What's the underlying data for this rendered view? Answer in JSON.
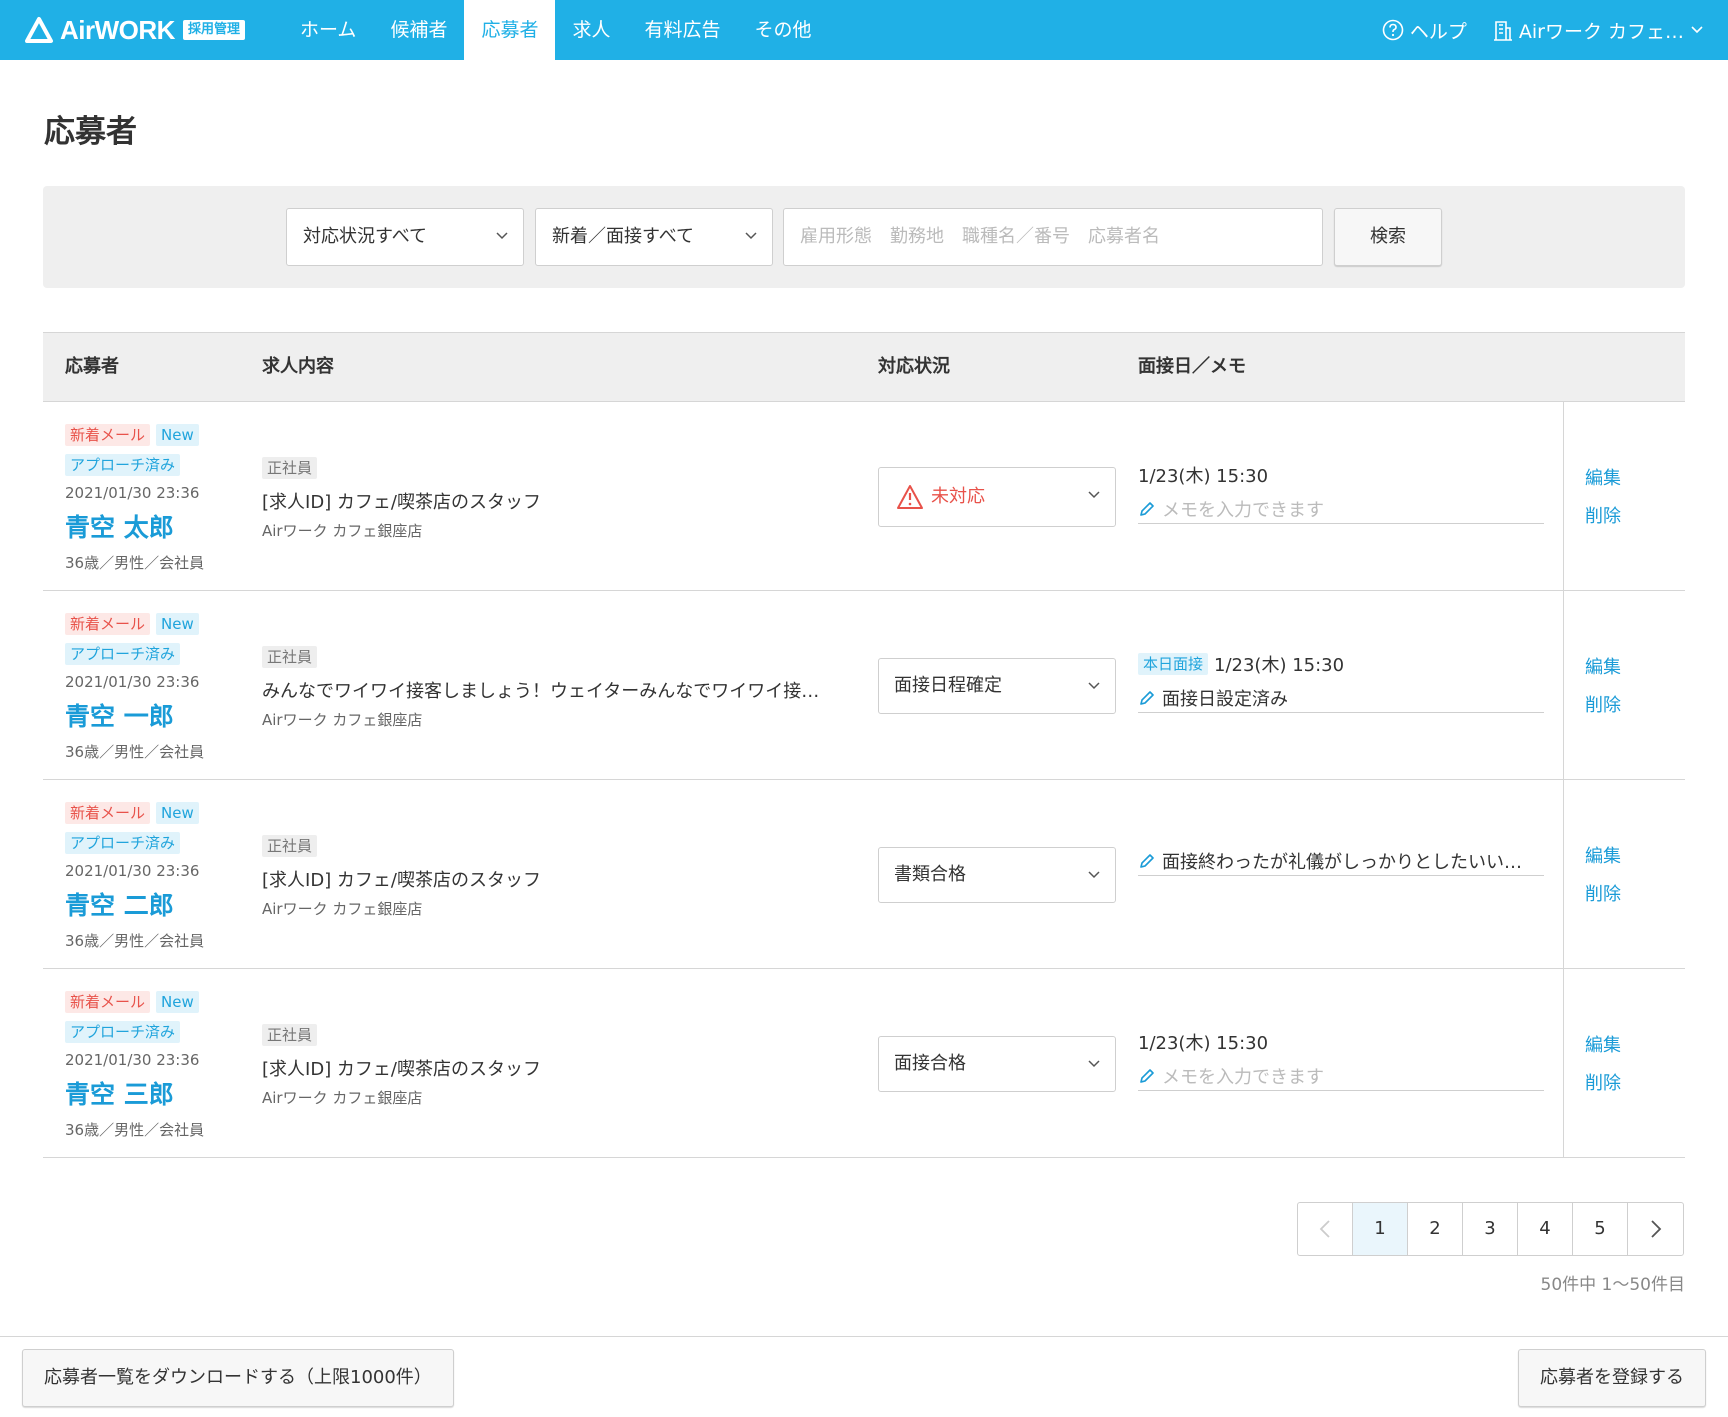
{
  "header": {
    "logo_text": "AirWORK",
    "logo_badge": "採用管理",
    "nav": [
      "ホーム",
      "候補者",
      "応募者",
      "求人",
      "有料広告",
      "その他"
    ],
    "active_nav": 2,
    "help": "ヘルプ",
    "account": "Airワーク カフェ…"
  },
  "page": {
    "title": "応募者"
  },
  "search": {
    "status_filter": "対応状況すべて",
    "new_filter": "新着／面接すべて",
    "keyword_placeholder": "雇用形態　勤務地　職種名／番号　応募者名",
    "button": "検索"
  },
  "table": {
    "columns": [
      "応募者",
      "求人内容",
      "対応状況",
      "面接日／メモ"
    ],
    "rows": [
      {
        "tag_mail": "新着メール",
        "tag_new": "New",
        "tag_approach": "アプローチ済み",
        "date": "2021/01/30 23:36",
        "name": "青空 太郎",
        "meta": "36歳／男性／会社員",
        "job_type": "正社員",
        "job_title": "[求人ID] カフェ/喫茶店のスタッフ",
        "job_shop": "Airワーク カフェ銀座店",
        "status": "未対応",
        "status_alert": true,
        "interview_badge": "",
        "interview_date": "1/23(木) 15:30",
        "memo": "",
        "memo_placeholder": "メモを入力できます",
        "edit": "編集",
        "delete": "削除"
      },
      {
        "tag_mail": "新着メール",
        "tag_new": "New",
        "tag_approach": "アプローチ済み",
        "date": "2021/01/30 23:36",
        "name": "青空 一郎",
        "meta": "36歳／男性／会社員",
        "job_type": "正社員",
        "job_title": "みんなでワイワイ接客しましょう！ウェイターみんなでワイワイ接…",
        "job_shop": "Airワーク カフェ銀座店",
        "status": "面接日程確定",
        "status_alert": false,
        "interview_badge": "本日面接",
        "interview_date": "1/23(木) 15:30",
        "memo": "面接日設定済み",
        "memo_placeholder": "",
        "edit": "編集",
        "delete": "削除"
      },
      {
        "tag_mail": "新着メール",
        "tag_new": "New",
        "tag_approach": "アプローチ済み",
        "date": "2021/01/30 23:36",
        "name": "青空 二郎",
        "meta": "36歳／男性／会社員",
        "job_type": "正社員",
        "job_title": "[求人ID] カフェ/喫茶店のスタッフ",
        "job_shop": "Airワーク カフェ銀座店",
        "status": "書類合格",
        "status_alert": false,
        "interview_badge": "",
        "interview_date": "",
        "memo": "面接終わったが礼儀がしっかりとしたいい…",
        "memo_placeholder": "",
        "edit": "編集",
        "delete": "削除"
      },
      {
        "tag_mail": "新着メール",
        "tag_new": "New",
        "tag_approach": "アプローチ済み",
        "date": "2021/01/30 23:36",
        "name": "青空 三郎",
        "meta": "36歳／男性／会社員",
        "job_type": "正社員",
        "job_title": "[求人ID] カフェ/喫茶店のスタッフ",
        "job_shop": "Airワーク カフェ銀座店",
        "status": "面接合格",
        "status_alert": false,
        "interview_badge": "",
        "interview_date": "1/23(木) 15:30",
        "memo": "",
        "memo_placeholder": "メモを入力できます",
        "edit": "編集",
        "delete": "削除"
      }
    ]
  },
  "pagination": {
    "pages": [
      "1",
      "2",
      "3",
      "4",
      "5"
    ],
    "current": 0,
    "count_text": "50件中 1〜50件目"
  },
  "footer": {
    "download": "応募者一覧をダウンロードする（上限1000件）",
    "register": "応募者を登録する"
  },
  "colors": {
    "brand": "#20b0e6",
    "link": "#1a9bd7",
    "alert": "#e8524a"
  }
}
